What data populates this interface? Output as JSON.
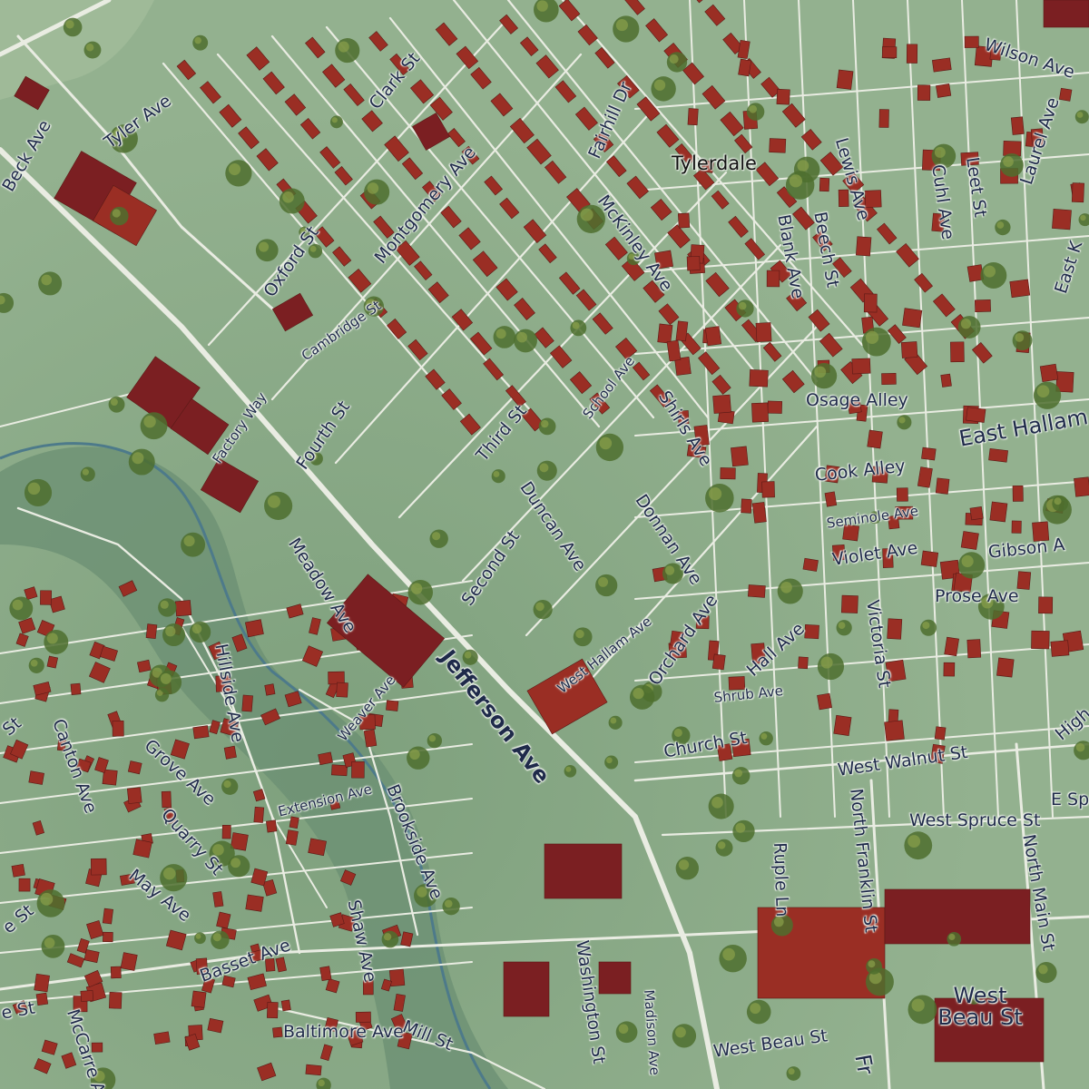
{
  "colors": {
    "ground": "#8fae8c",
    "ground_dark": "#6f9572",
    "river": "#5f8a73",
    "road": "#e9ece2",
    "building": "#9a2e24",
    "building_dark": "#7b1f22",
    "tree": "#4e6e2e",
    "label": "#1f2a4a"
  },
  "place_name": "Tylerdale",
  "streets": {
    "tyler_ave": "Tyler Ave",
    "clark_st": "Clark St",
    "fairhill_dr": "Fairhill Dr",
    "montgomery_ave": "Montgomery Ave",
    "mckinley_ave": "McKinley Ave",
    "lewis_ave": "Lewis Ave",
    "cuhl_ave": "Cuhl Ave",
    "leet_st": "Leet St",
    "laurel_ave": "Laurel Ave",
    "wilson_ave": "Wilson Ave",
    "east_k": "East K",
    "beck_ave": "Beck Ave",
    "oxford_st": "Oxford St",
    "cambridge_st": "Cambridge St",
    "fourth_st": "Fourth St",
    "factory_way": "Factory Way",
    "third_st": "Third St",
    "school_ave": "School Ave",
    "shirls_ave": "Shirls Ave",
    "blank_ave": "Blank Ave",
    "beech_st": "Beech St",
    "osage_alley": "Osage Alley",
    "east_hallam": "East Hallam",
    "cook_alley": "Cook Alley",
    "seminole_ave": "Seminole Ave",
    "violet_ave": "Violet Ave",
    "gibson_a": "Gibson A",
    "duncan_ave": "Duncan Ave",
    "donnan_ave": "Donnan Ave",
    "second_st": "Second St",
    "meadow_ave": "Meadow Ave",
    "jefferson_ave": "Jefferson Ave",
    "west_hallam_ave": "West Hallam Ave",
    "orchard_ave": "Orchard Ave",
    "hall_ave": "Hall Ave",
    "victoria_st": "Victoria St",
    "prose_ave": "Prose Ave",
    "shrub_ave": "Shrub Ave",
    "church_st": "Church St",
    "west_walnut_st": "West Walnut St",
    "high": "High",
    "hillside_ave": "Hillside Ave",
    "canton_ave": "Canton Ave",
    "grove_ave": "Grove Ave",
    "weaver_ave": "Weaver Ave",
    "extension_ave": "Extension Ave",
    "quarry_st": "Quarry St",
    "brookside_ave": "Brookside Ave",
    "may_ave": "May Ave",
    "shaw_ave": "Shaw Ave",
    "basset_ave": "Basset Ave",
    "west_spruce_st": "West Spruce St",
    "e_spru": "E Spru",
    "ruple_ln": "Ruple Ln",
    "north_franklin_st": "North Franklin St",
    "north_main_st": "North Main St",
    "washington_st": "Washington St",
    "madison_ave": "Madison Ave",
    "west_beau_st": "West Beau St",
    "west_beau_st_east": "West Beau St",
    "baltimore_ave": "Baltimore Ave",
    "mill_st": "Mill St",
    "mccarrell_ave": "McCarre Ave",
    "left_st_1": "St",
    "left_st_2": "e St",
    "left_st_3": "e St",
    "fr": "Fr"
  }
}
